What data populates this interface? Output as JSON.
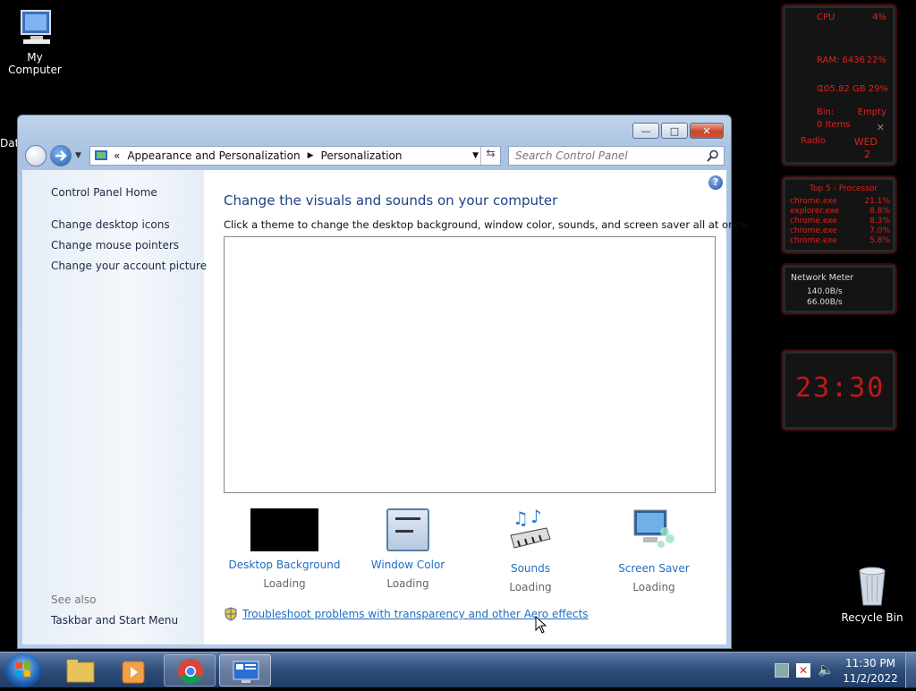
{
  "desktop": {
    "my_computer": "My Computer",
    "recycle_bin": "Recycle Bin",
    "partial_label": "Dat"
  },
  "window": {
    "breadcrumb": {
      "prefix": "«",
      "item1": "Appearance and Personalization",
      "item2": "Personalization"
    },
    "search_placeholder": "Search Control Panel",
    "sidebar": {
      "home": "Control Panel Home",
      "items": [
        "Change desktop icons",
        "Change mouse pointers",
        "Change your account picture"
      ],
      "see_also": "See also",
      "taskbar_link": "Taskbar and Start Menu"
    },
    "heading": "Change the visuals and sounds on your computer",
    "subtitle": "Click a theme to change the desktop background, window color, sounds, and screen saver all at once.",
    "options": [
      {
        "label": "Desktop Background",
        "status": "Loading"
      },
      {
        "label": "Window Color",
        "status": "Loading"
      },
      {
        "label": "Sounds",
        "status": "Loading"
      },
      {
        "label": "Screen Saver",
        "status": "Loading"
      }
    ],
    "troubleshoot": "Troubleshoot problems with transparency and other Aero effects"
  },
  "gadgets": {
    "cpu_label": "CPU",
    "cpu_val": "4%",
    "ram_label": "RAM: 6436",
    "ram_val": "22%",
    "disk_label": "C:",
    "disk_val": "105.82 GB 29%",
    "bin_label": "Bin:",
    "bin_val": "Empty",
    "bin_items": "0 Items",
    "radio": "Radio",
    "day": "WED",
    "date": "2",
    "top5_title": "Top 5 - Processor",
    "top5": [
      {
        "name": "chrome.exe",
        "val": "21.1%"
      },
      {
        "name": "explorer.exe",
        "val": "8.8%"
      },
      {
        "name": "chrome.exe",
        "val": "8.3%"
      },
      {
        "name": "chrome.exe",
        "val": "7.0%"
      },
      {
        "name": "chrome.exe",
        "val": "5.8%"
      }
    ],
    "net_title": "Network Meter",
    "net_up": "140.0B/s",
    "net_down": "66.00B/s",
    "clock": "23:30"
  },
  "taskbar": {
    "time": "11:30 PM",
    "date": "11/2/2022"
  },
  "colors": {
    "link": "#1f6dc2",
    "heading": "#1e3f87",
    "gadget_red": "#e0201c"
  }
}
